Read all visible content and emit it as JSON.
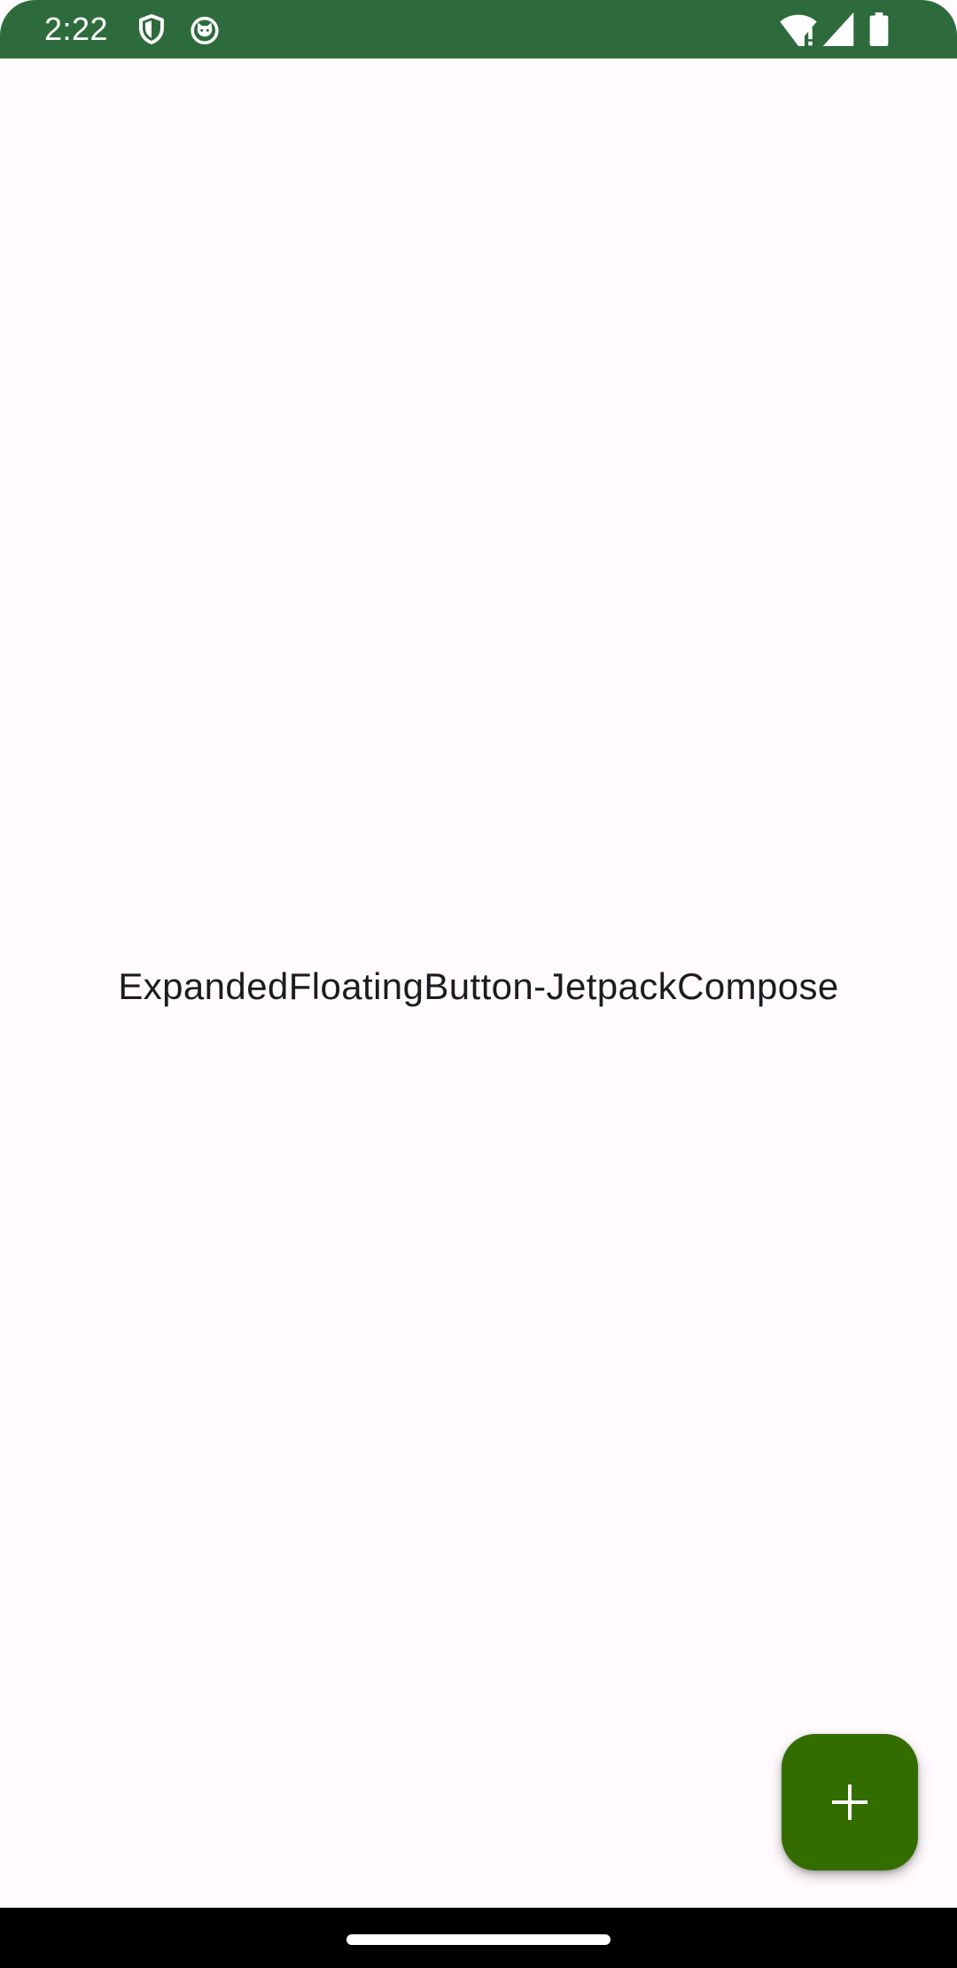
{
  "status_bar": {
    "time": "2:22",
    "background_color": "#2E6B3C",
    "left_icons": [
      "vpn-shield-icon",
      "cat-face-icon"
    ],
    "right_icons": [
      "wifi-alert-icon",
      "cell-signal-icon",
      "battery-icon"
    ]
  },
  "main": {
    "center_text": "ExpandedFloatingButton-JetpackCompose",
    "background_color": "#FFFBFE"
  },
  "fab": {
    "icon": "plus-icon",
    "color": "#336D00"
  },
  "navigation_bar": {
    "handle": "home-gesture-handle"
  }
}
